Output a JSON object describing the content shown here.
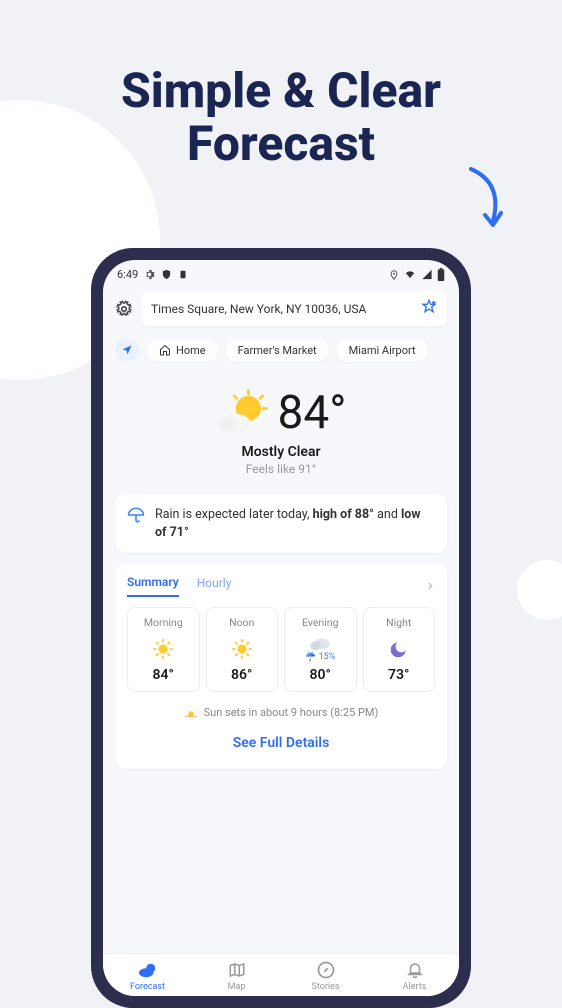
{
  "headline": {
    "line1": "Simple & Clear",
    "line2": "Forecast"
  },
  "status": {
    "time": "6:49"
  },
  "search": {
    "location": "Times Square, New York, NY 10036, USA"
  },
  "chips": [
    {
      "label": "Home",
      "icon": "home"
    },
    {
      "label": "Farmer's Market"
    },
    {
      "label": "Miami Airport"
    }
  ],
  "current": {
    "temp": "84°",
    "condition": "Mostly Clear",
    "feels": "Feels like 91°"
  },
  "summary": {
    "text_prefix": "Rain is expected later today, ",
    "high_label": "high of 88°",
    "mid": " and ",
    "low_label": "low of 71°"
  },
  "tabs": {
    "summary": "Summary",
    "hourly": "Hourly"
  },
  "periods": [
    {
      "label": "Morning",
      "icon": "sun",
      "temp": "84°"
    },
    {
      "label": "Noon",
      "icon": "sun",
      "temp": "86°"
    },
    {
      "label": "Evening",
      "icon": "cloud-rain",
      "precip": "15%",
      "temp": "80°"
    },
    {
      "label": "Night",
      "icon": "moon",
      "temp": "73°"
    }
  ],
  "sunset": "Sun sets in about 9 hours (8:25 PM)",
  "see_details": "See Full Details",
  "nav": [
    {
      "label": "Forecast",
      "icon": "forecast",
      "active": true
    },
    {
      "label": "Map",
      "icon": "map"
    },
    {
      "label": "Stories",
      "icon": "compass"
    },
    {
      "label": "Alerts",
      "icon": "bell"
    }
  ]
}
